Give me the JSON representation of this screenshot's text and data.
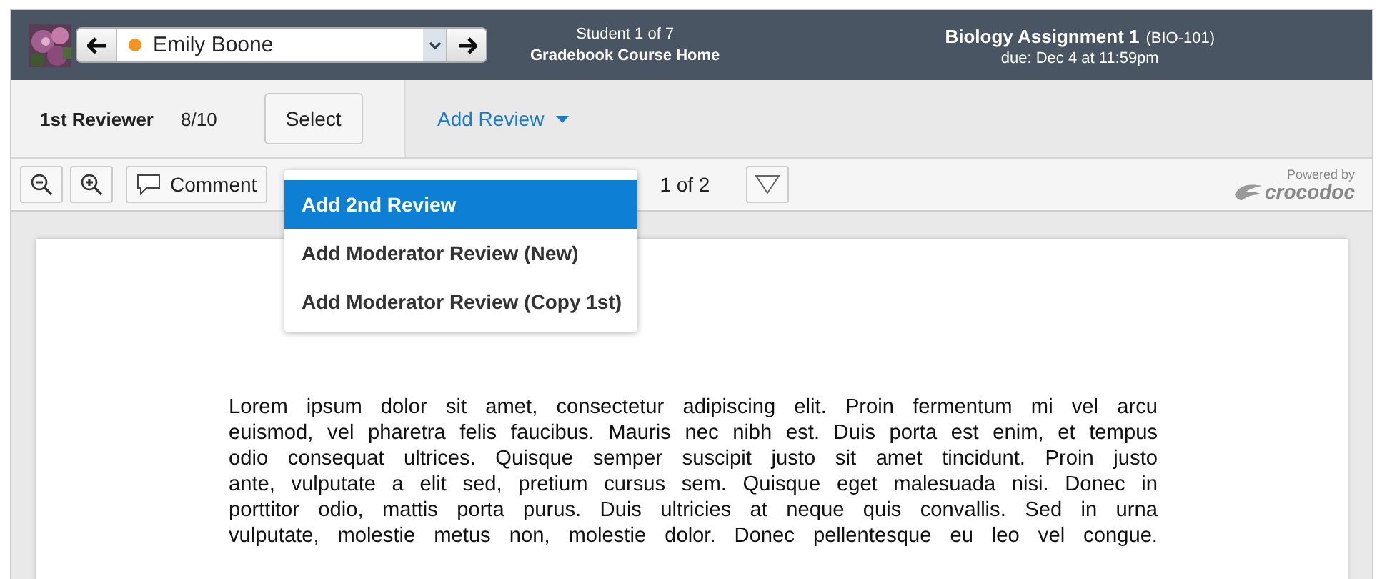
{
  "header": {
    "student": {
      "name": "Emily Boone",
      "color": "#f7941d"
    },
    "student_count": "Student 1 of 7",
    "course_link": "Gradebook Course Home",
    "assignment_title": "Biology Assignment 1",
    "course_code": "(BIO-101)",
    "due": "due: Dec 4 at 11:59pm"
  },
  "review_bar": {
    "reviewer": "1st Reviewer",
    "score": "8/10",
    "select_button": "Select",
    "add_review": "Add Review"
  },
  "review_menu": [
    {
      "label": "Add 2nd Review",
      "selected": true
    },
    {
      "label": "Add Moderator Review (New)",
      "selected": false
    },
    {
      "label": "Add Moderator Review (Copy 1st)",
      "selected": false
    }
  ],
  "doc_toolbar": {
    "comment_button": "Comment",
    "page": "1 of 2",
    "powered_by": "Powered by",
    "brand": "crocodoc"
  },
  "document": {
    "lines": [
      "Lorem ipsum dolor sit amet, consectetur adipiscing elit. Proin fermentum mi vel arcu",
      "euismod, vel pharetra felis faucibus. Mauris nec nibh est. Duis porta est enim, et tempus",
      "odio consequat ultrices. Quisque semper suscipit justo sit amet tincidunt. Proin justo",
      "ante, vulputate a elit sed, pretium cursus sem. Quisque eget malesuada nisi. Donec in",
      "porttitor odio, mattis porta purus. Duis ultricies at neque quis convallis. Sed in urna",
      "vulputate, molestie metus non, molestie dolor. Donec pellentesque eu leo vel congue."
    ]
  }
}
